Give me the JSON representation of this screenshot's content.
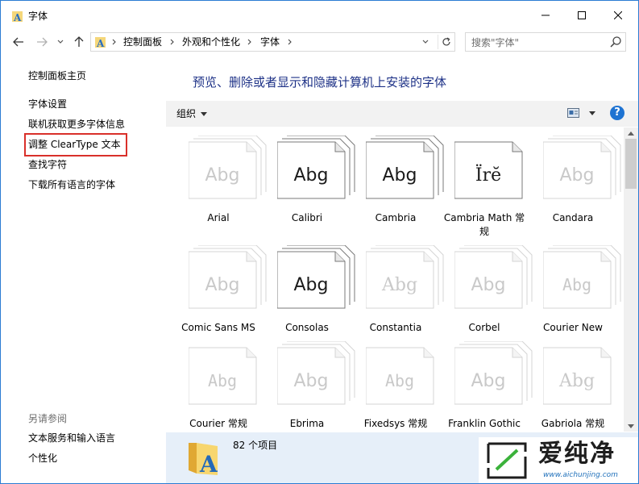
{
  "window": {
    "title": "字体"
  },
  "address": {
    "crumbs": [
      "控制面板",
      "外观和个性化",
      "字体"
    ],
    "search_placeholder": "搜索\"字体\""
  },
  "left_pane": {
    "home": "控制面板主页",
    "links": [
      "字体设置",
      "联机获取更多字体信息",
      "调整 ClearType 文本",
      "查找字符",
      "下载所有语言的字体"
    ],
    "see_also_title": "另请参阅",
    "see_also": [
      "文本服务和输入语言",
      "个性化"
    ]
  },
  "main": {
    "header": "预览、删除或者显示和隐藏计算机上安装的字体",
    "toolbar": {
      "organize": "组织",
      "help": "?"
    },
    "fonts": [
      {
        "name": "Arial",
        "sample": "Abg",
        "style": "family",
        "active": false,
        "font": "sans"
      },
      {
        "name": "Calibri",
        "sample": "Abg",
        "style": "family",
        "active": true,
        "font": "sans"
      },
      {
        "name": "Cambria",
        "sample": "Abg",
        "style": "family",
        "active": true,
        "font": "sans"
      },
      {
        "name": "Cambria Math 常规",
        "sample": "Ïrĕ",
        "style": "single",
        "active": true,
        "font": "serif"
      },
      {
        "name": "Candara",
        "sample": "Abg",
        "style": "family",
        "active": false,
        "font": "sans"
      },
      {
        "name": "Comic Sans MS",
        "sample": "Abg",
        "style": "family",
        "active": false,
        "font": "sans"
      },
      {
        "name": "Consolas",
        "sample": "Abg",
        "style": "family",
        "active": true,
        "font": "sans"
      },
      {
        "name": "Constantia",
        "sample": "Abg",
        "style": "family",
        "active": false,
        "font": "serif"
      },
      {
        "name": "Corbel",
        "sample": "Abg",
        "style": "family",
        "active": false,
        "font": "sans"
      },
      {
        "name": "Courier New",
        "sample": "Abg",
        "style": "family",
        "active": false,
        "font": "mono"
      },
      {
        "name": "Courier 常规",
        "sample": "Abg",
        "style": "single",
        "active": false,
        "font": "mono"
      },
      {
        "name": "Ebrima",
        "sample": "Abg",
        "style": "family",
        "active": false,
        "font": "sans"
      },
      {
        "name": "Fixedsys 常规",
        "sample": "Abg",
        "style": "single",
        "active": false,
        "font": "mono"
      },
      {
        "name": "Franklin Gothic",
        "sample": "Abg",
        "style": "family",
        "active": false,
        "font": "sans"
      },
      {
        "name": "Gabriola 常规",
        "sample": "Abg",
        "style": "single",
        "active": false,
        "font": "serif"
      }
    ]
  },
  "details": {
    "count": "82 个项目"
  },
  "watermark": {
    "text": "爱纯净",
    "url": "www.aichunjing.com"
  },
  "colors": {
    "window_border": "#2b7cd3",
    "header_text": "#1e3287",
    "toolbar_bg": "#f2f2f2",
    "details_bg": "#e6eff9",
    "highlight_border": "#d9302a",
    "help_blue": "#1e73d2"
  }
}
